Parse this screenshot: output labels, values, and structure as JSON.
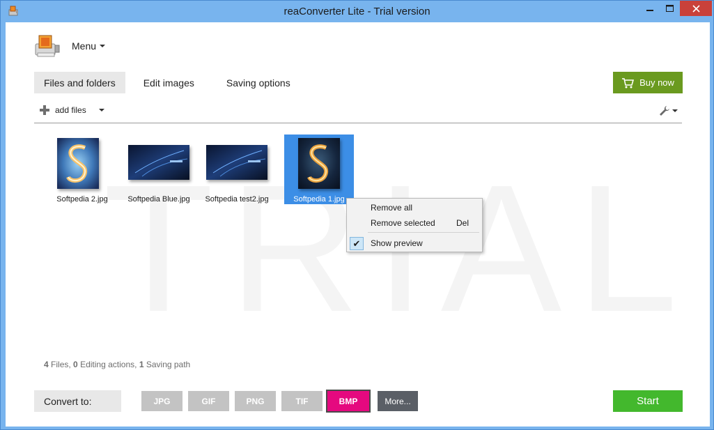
{
  "window": {
    "title": "reaConverter Lite - Trial version",
    "minimize": "—",
    "maximize": "□",
    "close": "✕"
  },
  "menu": {
    "label": "Menu"
  },
  "tabs": [
    {
      "label": "Files and folders",
      "active": true
    },
    {
      "label": "Edit images",
      "active": false
    },
    {
      "label": "Saving options",
      "active": false
    }
  ],
  "buy_button": {
    "label": "Buy now"
  },
  "toolbar": {
    "add_files_label": "add files"
  },
  "watermark": "TRIAL",
  "thumbnails": [
    {
      "filename": "Softpedia 2.jpg",
      "selected": false
    },
    {
      "filename": "Softpedia Blue.jpg",
      "selected": false
    },
    {
      "filename": "Softpedia test2.jpg",
      "selected": false
    },
    {
      "filename": "Softpedia 1.jpg",
      "selected": true
    }
  ],
  "context_menu": {
    "items": [
      {
        "label": "Remove all",
        "shortcut": ""
      },
      {
        "label": "Remove selected",
        "shortcut": "Del"
      },
      {
        "label": "Show preview",
        "shortcut": "",
        "checked": true
      }
    ]
  },
  "status": {
    "files_count": "4",
    "files_label": "Files,",
    "editing_count": "0",
    "editing_label": "Editing actions,",
    "saving_count": "1",
    "saving_label": "Saving path"
  },
  "convert": {
    "label": "Convert to:",
    "formats": [
      "JPG",
      "GIF",
      "PNG",
      "TIF",
      "BMP"
    ],
    "active_format": "BMP",
    "more_label": "More..."
  },
  "start_button": {
    "label": "Start"
  },
  "colors": {
    "titlebar": "#78b4ee",
    "close": "#c9413a",
    "buy": "#6a9a1f",
    "start": "#43b82d",
    "active_format": "#e5097f",
    "selection": "#3c8ee6"
  }
}
